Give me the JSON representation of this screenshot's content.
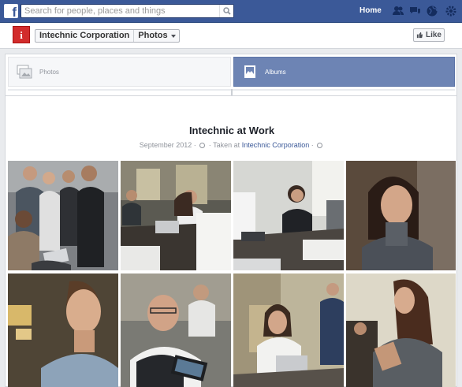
{
  "topbar": {
    "logo": "f",
    "search_placeholder": "Search for people, places and things",
    "home_label": "Home",
    "icons": [
      "friend-requests-icon",
      "messages-icon",
      "notifications-globe-icon",
      "settings-gear-icon"
    ]
  },
  "page_header": {
    "avatar_letter": "i",
    "page_name": "Intechnic Corporation",
    "section": "Photos",
    "like_label": "Like"
  },
  "tabs": [
    {
      "label": "Photos",
      "selected": false
    },
    {
      "label": "Albums",
      "selected": true
    }
  ],
  "album": {
    "title": "Intechnic at Work",
    "date": "September 2012",
    "taken_at_label": "Taken at",
    "location": "Intechnic Corporation"
  },
  "photos": [
    {
      "name": "group-tablet"
    },
    {
      "name": "meeting-laptop"
    },
    {
      "name": "conference-table"
    },
    {
      "name": "portrait-woman"
    },
    {
      "name": "smiling-man"
    },
    {
      "name": "man-glasses-tablet"
    },
    {
      "name": "woman-laptop"
    },
    {
      "name": "woman-looking-away"
    }
  ],
  "colors": {
    "brand_blue": "#3b5998",
    "tab_selected": "#6d84b4",
    "link": "#3b5998"
  }
}
